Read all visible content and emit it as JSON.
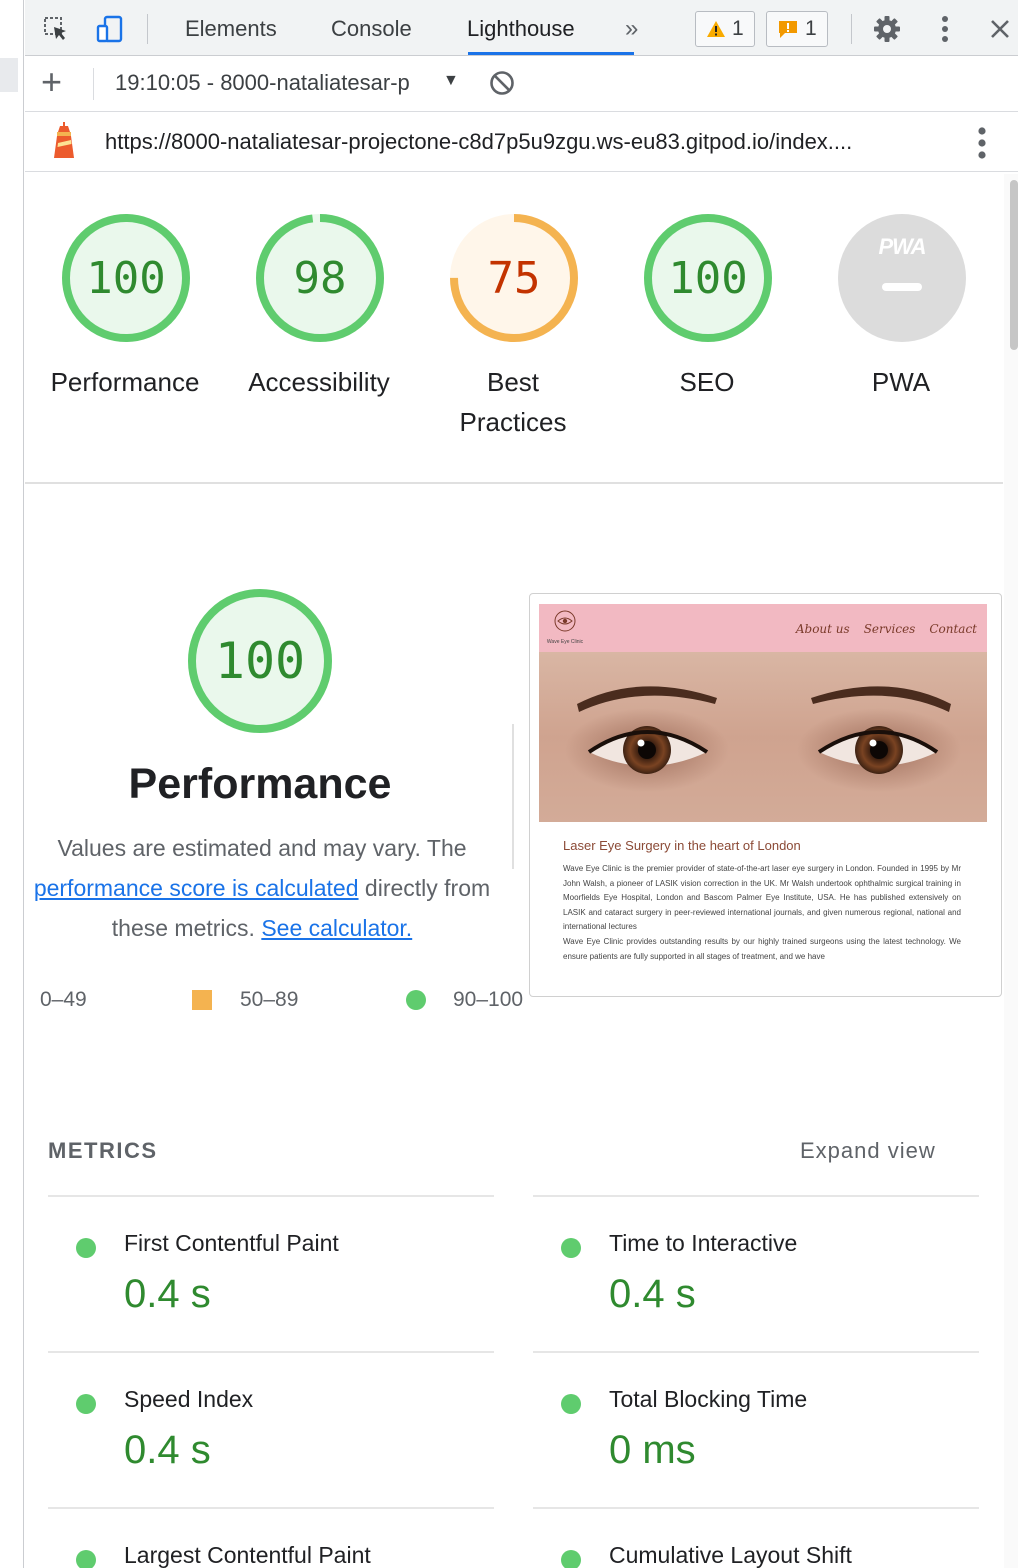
{
  "devtools": {
    "tabs": [
      {
        "label": "Elements"
      },
      {
        "label": "Console"
      },
      {
        "label": "Lighthouse"
      }
    ],
    "more_tabs_glyph": "»",
    "warnings_count": "1",
    "issues_count": "1",
    "icons": [
      "inspect-element-icon",
      "device-toolbar-icon",
      "gear-icon",
      "kebab-menu-icon",
      "close-icon"
    ]
  },
  "lighthouse_toolbar": {
    "add_glyph": "+",
    "report_selector": "19:10:05 - 8000-nataliatesar-p",
    "url": "https://8000-nataliatesar-projectone-c8d7p5u9zgu.ws-eu83.gitpod.io/index...."
  },
  "scores": [
    {
      "value": "100",
      "label": "Performance",
      "fraction": 1.0
    },
    {
      "value": "98",
      "label": "Accessibility",
      "fraction": 0.98
    },
    {
      "value": "75",
      "label": "Best Practices",
      "label_line1": "Best",
      "label_line2": "Practices",
      "fraction": 0.75
    },
    {
      "value": "100",
      "label": "SEO",
      "fraction": 1.0
    },
    {
      "value": "",
      "label": "PWA",
      "badge_text": "PWA",
      "badge_symbol": "—"
    }
  ],
  "performance_section": {
    "score": "100",
    "title": "Performance",
    "desc_part1": "Values are estimated and may vary. The",
    "desc_link1": "performance score is calculated",
    "desc_part2": "directly from",
    "desc_part3": "these metrics.",
    "desc_link2": "See calculator.",
    "legend": [
      {
        "range": "0–49"
      },
      {
        "range": "50–89"
      },
      {
        "range": "90–100"
      }
    ]
  },
  "preview": {
    "site_name": "Wave Eye Clinic",
    "nav_links": [
      "About us",
      "Services",
      "Contact"
    ],
    "heading": "Laser Eye Surgery in the heart of London",
    "paragraph1": "Wave Eye Clinic is the premier provider of state-of-the-art laser eye surgery in London. Founded in 1995 by Mr John Walsh, a pioneer of LASIK vision correction in the UK. Mr Walsh undertook ophthalmic surgical training in Moorfields Eye Hospital, London and Bascom Palmer Eye Institute, USA. He has published extensively on LASIK and cataract surgery in peer-reviewed international journals, and given numerous regional, national and international lectures",
    "paragraph2": "Wave Eye Clinic provides outstanding results by our highly trained surgeons using the latest technology. We ensure patients are fully supported in all stages of treatment, and we have"
  },
  "metrics": {
    "heading": "METRICS",
    "expand_label": "Expand view",
    "items": [
      {
        "name": "First Contentful Paint",
        "value": "0.4 s"
      },
      {
        "name": "Time to Interactive",
        "value": "0.4 s"
      },
      {
        "name": "Speed Index",
        "value": "0.4 s"
      },
      {
        "name": "Total Blocking Time",
        "value": "0 ms"
      },
      {
        "name": "Largest Contentful Paint",
        "value": ""
      },
      {
        "name": "Cumulative Layout Shift",
        "value": ""
      }
    ]
  },
  "colors": {
    "pass": "#0cce6b",
    "pass_text": "#008800",
    "average": "#ffa400",
    "average_text": "#c33300",
    "link": "#1a73e8"
  }
}
